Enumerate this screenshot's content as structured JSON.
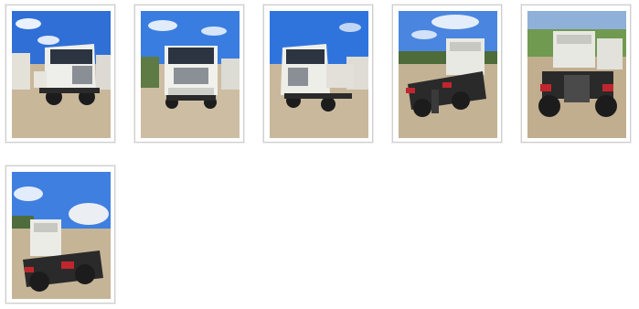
{
  "gallery": {
    "thumbnails": [
      {
        "id": "thumb-1",
        "view": "cab-front-three-quarter-left",
        "sky": "#2f6fd6",
        "ground": "#c9b79a",
        "cab": "#eeeeea"
      },
      {
        "id": "thumb-2",
        "view": "cab-front",
        "sky": "#3a7de0",
        "ground": "#cdbda2",
        "cab": "#f1f1ec"
      },
      {
        "id": "thumb-3",
        "view": "cab-front-three-quarter-right",
        "sky": "#2f74dc",
        "ground": "#c9b89c",
        "cab": "#eeeee8"
      },
      {
        "id": "thumb-4",
        "view": "chassis-rear-three-quarter",
        "sky": "#4a86df",
        "ground": "#c3b293",
        "cab": "#e9e9e4"
      },
      {
        "id": "thumb-5",
        "view": "chassis-rear",
        "sky": "#6f9a4f",
        "ground": "#c1ae8f",
        "cab": "#e8e8e2"
      },
      {
        "id": "thumb-6",
        "view": "chassis-rear-three-quarter-left",
        "sky": "#3f7fe0",
        "ground": "#c5b596",
        "cab": "#ecece6"
      }
    ]
  },
  "colors": {
    "border": "#cfcfcf",
    "tail_light": "#c0262d",
    "tyre": "#1c1c1c",
    "chassis": "#2a2a2a"
  }
}
